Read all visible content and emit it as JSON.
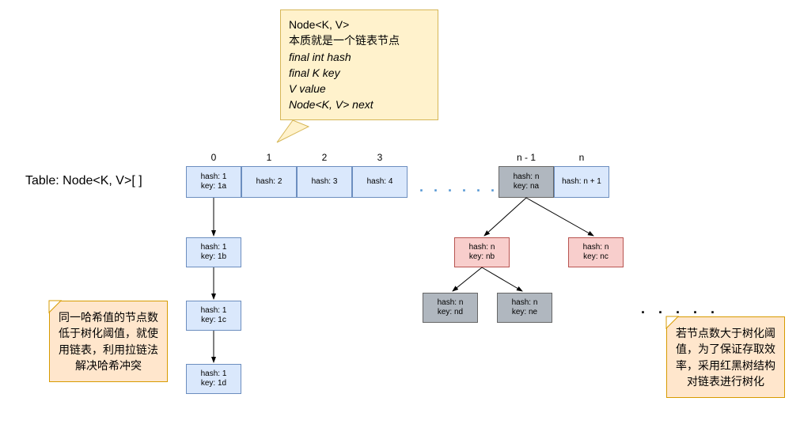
{
  "table_label": "Table:  Node<K, V>[ ]",
  "callout": {
    "title": "Node<K, V>",
    "sub": "本质就是一个链表节点",
    "f1": "final int hash",
    "f2": "final K key",
    "f3": "V value",
    "f4": "Node<K, V> next"
  },
  "idx": {
    "i0": "0",
    "i1": "1",
    "i2": "2",
    "i3": "3",
    "in1": "n - 1",
    "in": "n"
  },
  "cells": {
    "c0a": "hash: 1",
    "c0b": "key: 1a",
    "c1": "hash: 2",
    "c2": "hash: 3",
    "c3": "hash: 4",
    "cn1a": "hash: n",
    "cn1b": "key: na",
    "cn": "hash: n + 1"
  },
  "chain": {
    "n1a": "hash: 1",
    "n1b": "key: 1b",
    "n2a": "hash: 1",
    "n2b": "key: 1c",
    "n3a": "hash: 1",
    "n3b": "key: 1d"
  },
  "tree": {
    "l1a": "hash: n",
    "l1b": "key: nb",
    "r1a": "hash: n",
    "r1b": "key: nc",
    "l2a": "hash: n",
    "l2b": "key: nd",
    "r2a": "hash: n",
    "r2b": "key: ne"
  },
  "note_left": "同一哈希值的节点数低于树化阈值，就使用链表，利用拉链法解决哈希冲突",
  "note_right": "若节点数大于树化阈值，为了保证存取效率，采用红黑树结构对链表进行树化",
  "dots_mid": ". . . . . .",
  "dots_right": ". . . . ."
}
